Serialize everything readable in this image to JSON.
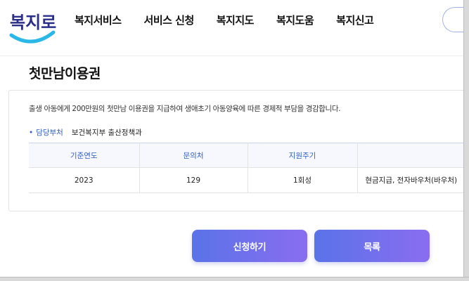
{
  "logo": {
    "text": "복지로",
    "color_main": "#2b2f8a",
    "color_smile": "#2ab8e6"
  },
  "nav": {
    "items": [
      {
        "label": "복지서비스"
      },
      {
        "label": "서비스 신청"
      },
      {
        "label": "복지지도"
      },
      {
        "label": "복지도움"
      },
      {
        "label": "복지신고"
      }
    ]
  },
  "page": {
    "title": "첫만남이용권",
    "description": "출생 아동에게 200만원의 첫만남 이용권을 지급하여 생애초기 아동양육에 따른 경제적 부담을 경감합니다.",
    "department_label": "담당부처",
    "department_value": "보건복지부 출산정책과"
  },
  "table": {
    "headers": [
      "기준연도",
      "문의처",
      "지원주기",
      ""
    ],
    "rows": [
      [
        "2023",
        "129",
        "1회성",
        "현금지급, 전자바우처(바우처)"
      ]
    ]
  },
  "buttons": {
    "apply_label": "신청하기",
    "list_label": "목록"
  },
  "colors": {
    "accent": "#2f5ec4",
    "button_gradient_start": "#5a73e8",
    "button_gradient_end": "#8a6df0"
  }
}
